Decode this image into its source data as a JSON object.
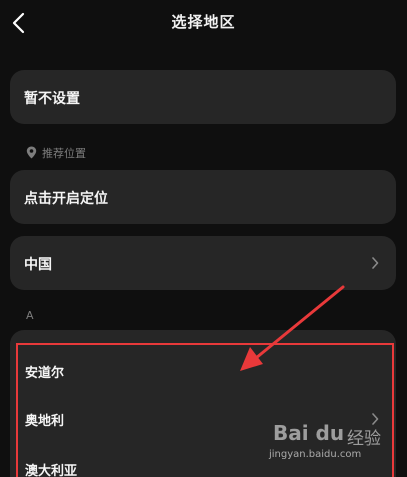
{
  "header": {
    "title": "选择地区",
    "back_icon": "chevron-left-icon"
  },
  "options": {
    "no_setting": "暂不设置",
    "enable_location": "点击开启定位",
    "china": "中国"
  },
  "sections": {
    "recommended": "推荐位置",
    "recommended_icon": "location-pin-icon",
    "letter_a": "A"
  },
  "countries_a": [
    {
      "label": "安道尔"
    },
    {
      "label": "奥地利"
    },
    {
      "label": "澳大利亚"
    }
  ],
  "annotation": {
    "highlight_color": "#e8393a"
  },
  "watermark": {
    "logo": "Bai du",
    "cn": "经验",
    "url": "jingyan.baidu.com"
  },
  "colors": {
    "background": "#0f0f0f",
    "card": "#262626",
    "muted_text": "#7d7d7d"
  }
}
